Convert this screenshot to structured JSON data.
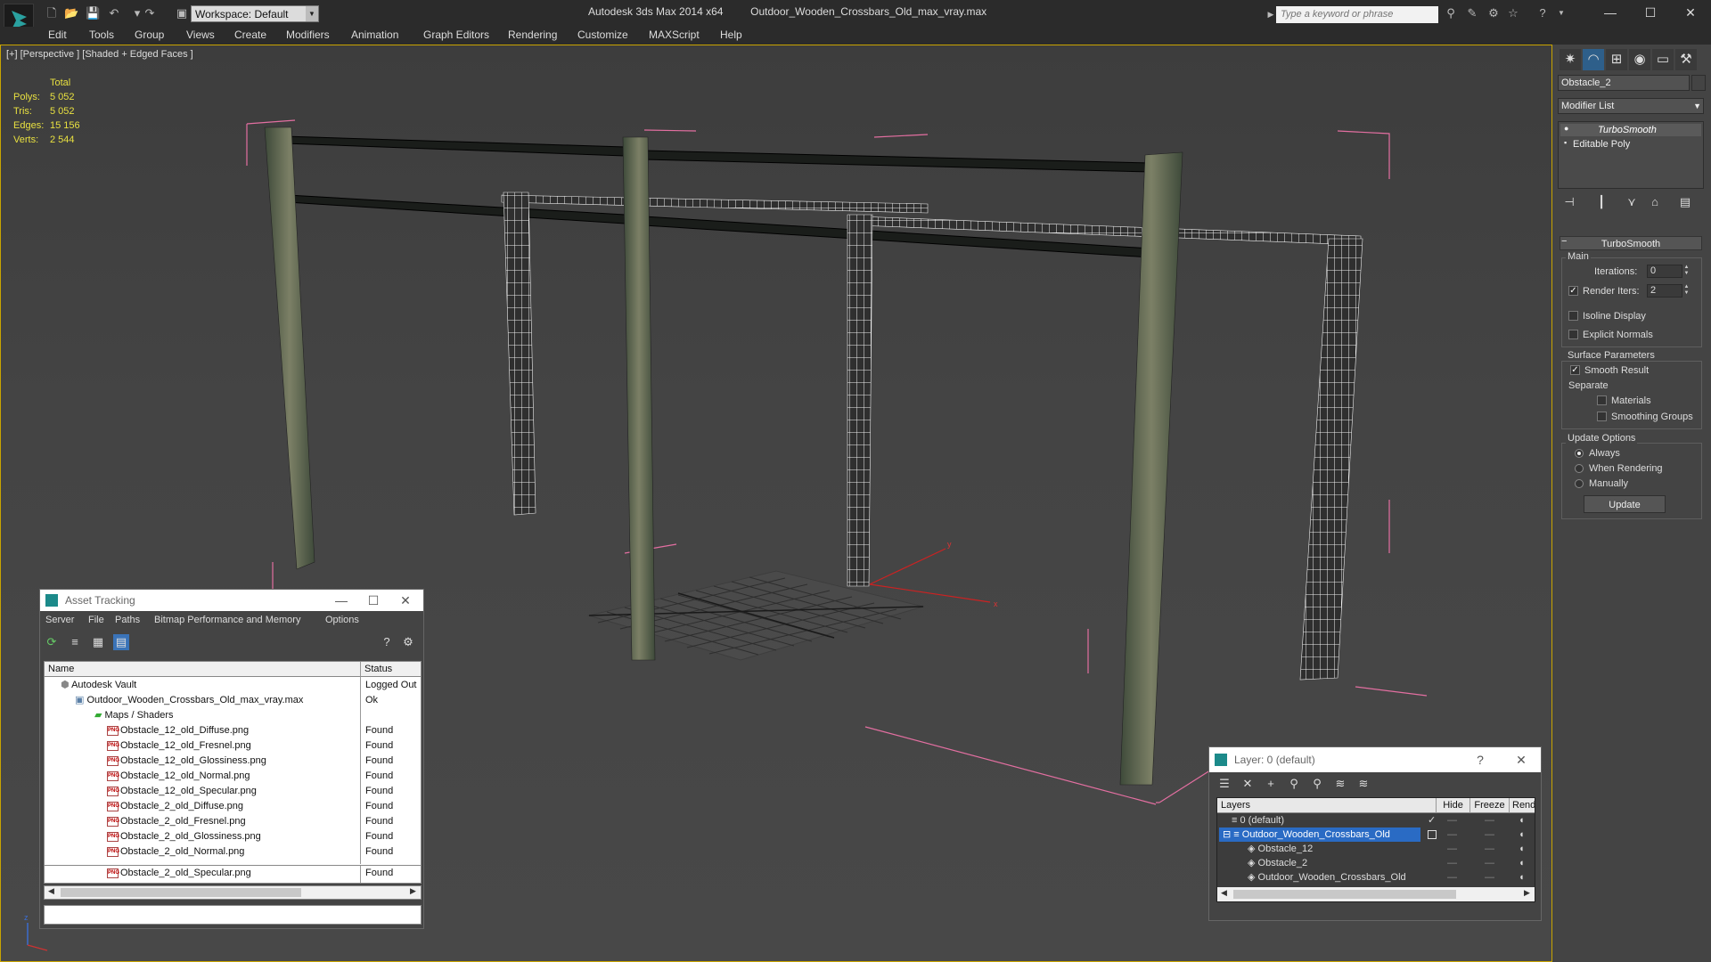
{
  "titlebar": {
    "app_title": "Autodesk 3ds Max  2014 x64",
    "file_name": "Outdoor_Wooden_Crossbars_Old_max_vray.max",
    "workspace": "Workspace: Default",
    "search_placeholder": "Type a keyword or phrase"
  },
  "menu": [
    "Edit",
    "Tools",
    "Group",
    "Views",
    "Create",
    "Modifiers",
    "Animation",
    "Graph Editors",
    "Rendering",
    "Customize",
    "MAXScript",
    "Help"
  ],
  "viewport": {
    "label": "[+] [Perspective ] [Shaded + Edged Faces ]",
    "stats": {
      "header": "Total",
      "rows": [
        {
          "label": "Polys:",
          "value": "5 052"
        },
        {
          "label": "Tris:",
          "value": "5 052"
        },
        {
          "label": "Edges:",
          "value": "15 156"
        },
        {
          "label": "Verts:",
          "value": "2 544"
        }
      ]
    },
    "axis_labels": {
      "y": "y",
      "x": "x",
      "z": "z"
    }
  },
  "command_panel": {
    "object_name": "Obstacle_2",
    "modifier_list": "Modifier List",
    "stack": [
      "TurboSmooth",
      "Editable Poly"
    ],
    "rollout_title": "TurboSmooth",
    "main": {
      "label": "Main",
      "iterations_label": "Iterations:",
      "iterations_value": "0",
      "render_iters_label": "Render Iters:",
      "render_iters_value": "2",
      "isoline": "Isoline Display",
      "explicit": "Explicit Normals"
    },
    "surface": {
      "label": "Surface Parameters",
      "smooth": "Smooth Result",
      "separate": "Separate",
      "materials": "Materials",
      "smoothing_groups": "Smoothing Groups"
    },
    "update": {
      "label": "Update Options",
      "always": "Always",
      "when_rendering": "When Rendering",
      "manually": "Manually",
      "button": "Update"
    }
  },
  "asset_tracking": {
    "title": "Asset Tracking",
    "menu": [
      "Server",
      "File",
      "Paths",
      "Bitmap Performance and Memory",
      "Options"
    ],
    "columns": [
      "Name",
      "Status"
    ],
    "rows": [
      {
        "name": "Autodesk Vault",
        "status": "Logged Out"
      },
      {
        "name": "Outdoor_Wooden_Crossbars_Old_max_vray.max",
        "status": "Ok"
      },
      {
        "name": "Maps / Shaders",
        "status": ""
      },
      {
        "name": "Obstacle_12_old_Diffuse.png",
        "status": "Found"
      },
      {
        "name": "Obstacle_12_old_Fresnel.png",
        "status": "Found"
      },
      {
        "name": "Obstacle_12_old_Glossiness.png",
        "status": "Found"
      },
      {
        "name": "Obstacle_12_old_Normal.png",
        "status": "Found"
      },
      {
        "name": "Obstacle_12_old_Specular.png",
        "status": "Found"
      },
      {
        "name": "Obstacle_2_old_Diffuse.png",
        "status": "Found"
      },
      {
        "name": "Obstacle_2_old_Fresnel.png",
        "status": "Found"
      },
      {
        "name": "Obstacle_2_old_Glossiness.png",
        "status": "Found"
      },
      {
        "name": "Obstacle_2_old_Normal.png",
        "status": "Found"
      },
      {
        "name": "Obstacle_2_old_Specular.png",
        "status": "Found"
      }
    ],
    "file_badge": "PNG"
  },
  "layer_dialog": {
    "title": "Layer: 0 (default)",
    "help": "?",
    "columns": [
      "Layers",
      "Hide",
      "Freeze",
      "Rend"
    ],
    "rows": [
      {
        "name": "0 (default)"
      },
      {
        "name": "Outdoor_Wooden_Crossbars_Old"
      },
      {
        "name": "Obstacle_12"
      },
      {
        "name": "Obstacle_2"
      },
      {
        "name": "Outdoor_Wooden_Crossbars_Old"
      }
    ],
    "dash": "—"
  }
}
